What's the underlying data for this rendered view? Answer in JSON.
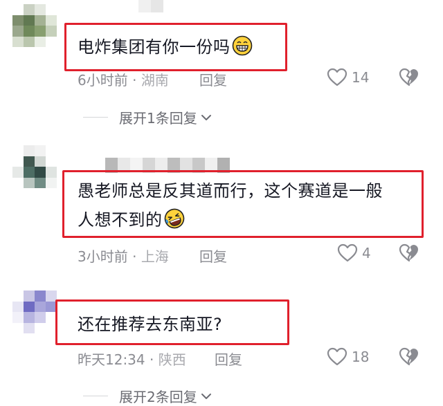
{
  "comments": [
    {
      "text": "电炸集团有你一份吗",
      "emoji": "grinning-face-emoji",
      "time": "6小时前",
      "sep": "·",
      "location": "湖南",
      "reply_label": "回复",
      "likes": "14",
      "expand_label": "展开1条回复"
    },
    {
      "text_line1": "愚老师总是反其道而行，这个赛道是一般",
      "text_line2": "人想不到的",
      "emoji": "rolling-on-floor-laughing-emoji",
      "time": "3小时前",
      "sep": "·",
      "location": "上海",
      "reply_label": "回复",
      "likes": "4"
    },
    {
      "text": "还在推荐去东南亚?",
      "time": "昨天12:34",
      "sep": "·",
      "location": "陕西",
      "reply_label": "回复",
      "likes": "18",
      "expand_label": "展开2条回复"
    }
  ],
  "colors": {
    "highlight_border": "#e0202c",
    "meta_text": "#8a8b91",
    "body_text": "#161823"
  }
}
